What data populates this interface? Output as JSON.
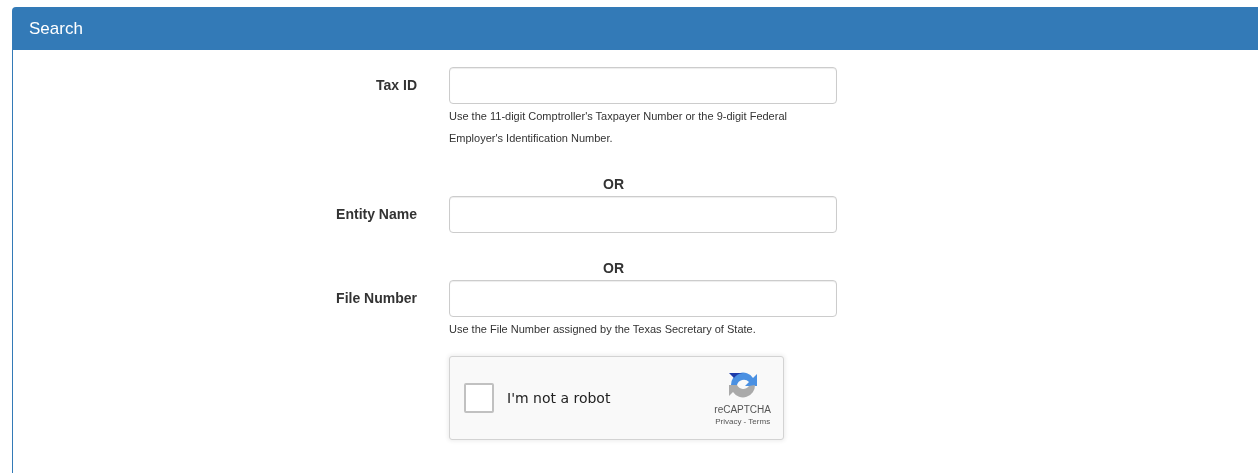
{
  "panel": {
    "title": "Search"
  },
  "rows": [
    {
      "kind": "field",
      "label": "Tax ID",
      "help": "Use the 11-digit Comptroller's Taxpayer Number or the 9-digit Federal Employer's Identification Number."
    },
    {
      "kind": "or",
      "text": "OR"
    },
    {
      "kind": "field",
      "label": "Entity Name"
    },
    {
      "kind": "or",
      "text": "OR"
    },
    {
      "kind": "field",
      "label": "File Number",
      "help": "Use the File Number assigned by the Texas Secretary of State."
    },
    {
      "kind": "captcha",
      "checked": false,
      "label": "I'm not a robot",
      "brand": "reCAPTCHA",
      "links": "Privacy - Terms"
    }
  ]
}
